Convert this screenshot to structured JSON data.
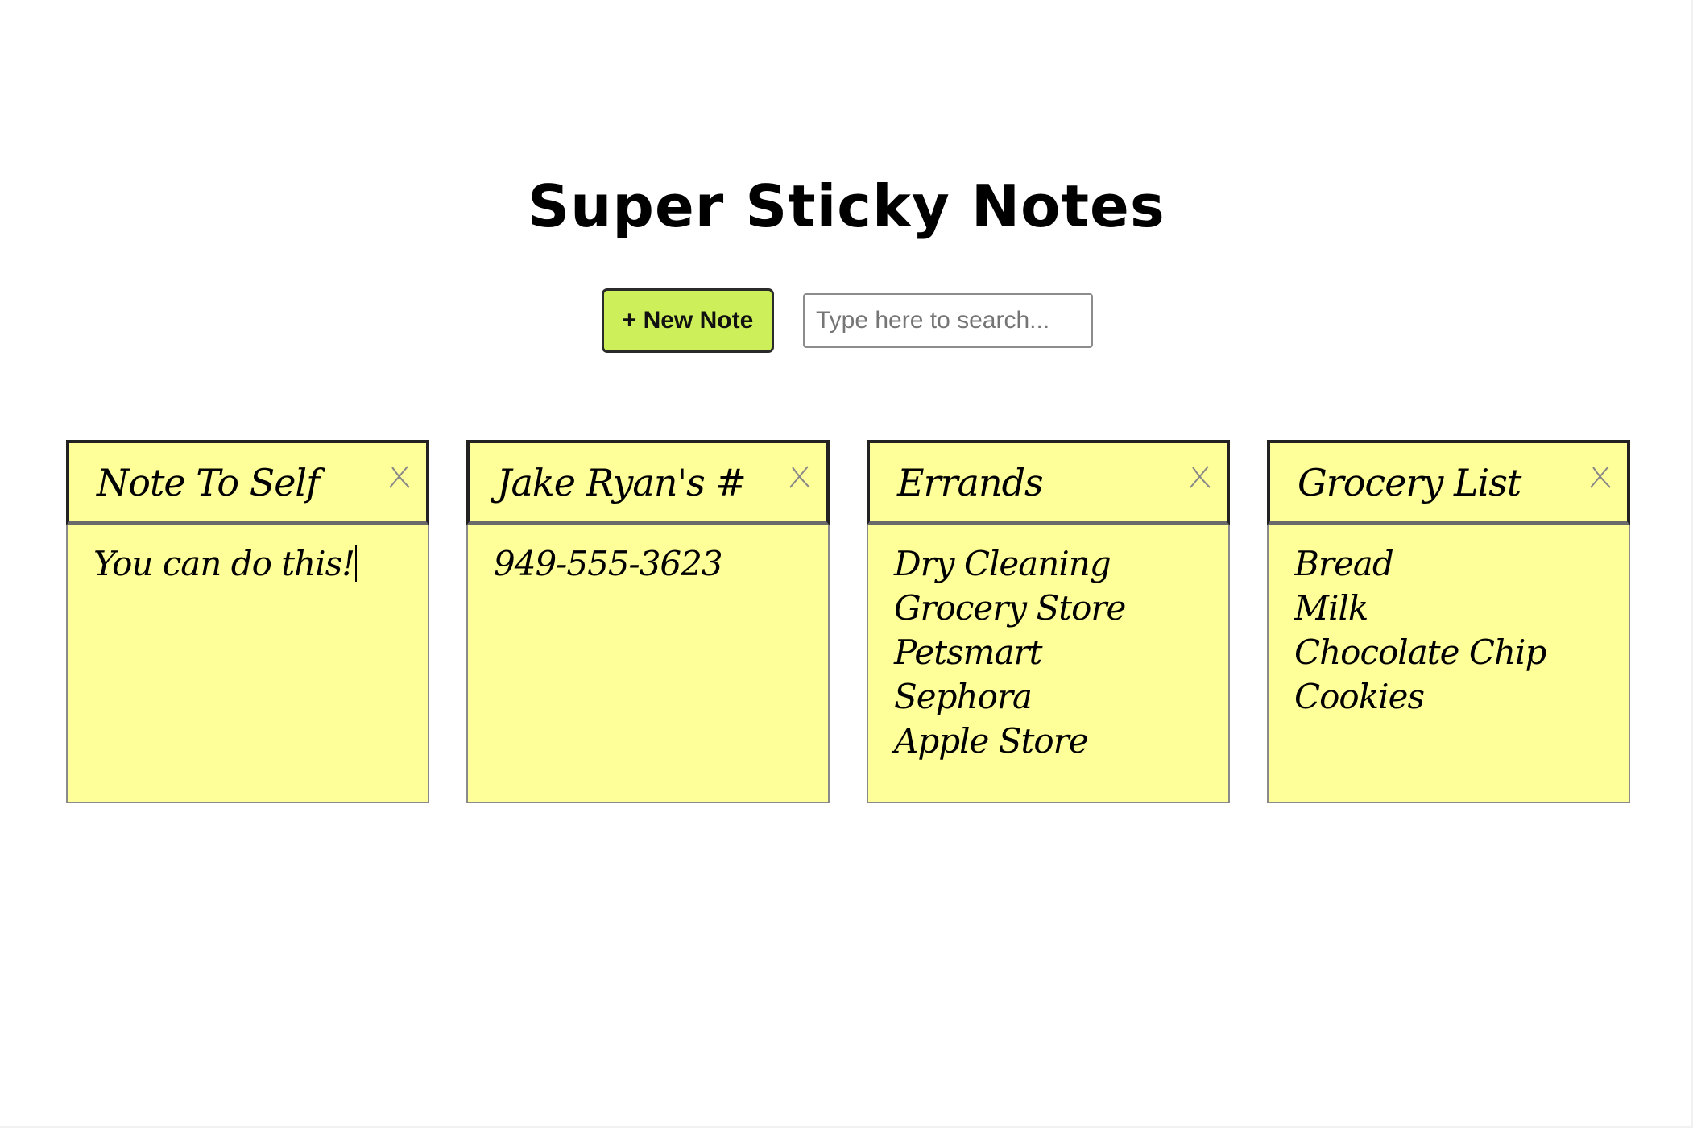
{
  "header": {
    "title": "Super Sticky Notes"
  },
  "toolbar": {
    "new_note_label": "+ New Note",
    "search_placeholder": "Type here to search...",
    "search_value": ""
  },
  "notes": [
    {
      "title": "Note To Self",
      "body": "You can do this!"
    },
    {
      "title": "Jake Ryan's #",
      "body": "949-555-3623"
    },
    {
      "title": "Errands",
      "body": "Dry Cleaning\nGrocery Store\nPetsmart\nSephora\nApple Store"
    },
    {
      "title": "Grocery List",
      "body": "Bread\nMilk\nChocolate Chip\nCookies"
    }
  ],
  "colors": {
    "note_background": "#ffff99",
    "button_background": "#cdef5a"
  },
  "icons": {
    "close": "close-icon"
  }
}
